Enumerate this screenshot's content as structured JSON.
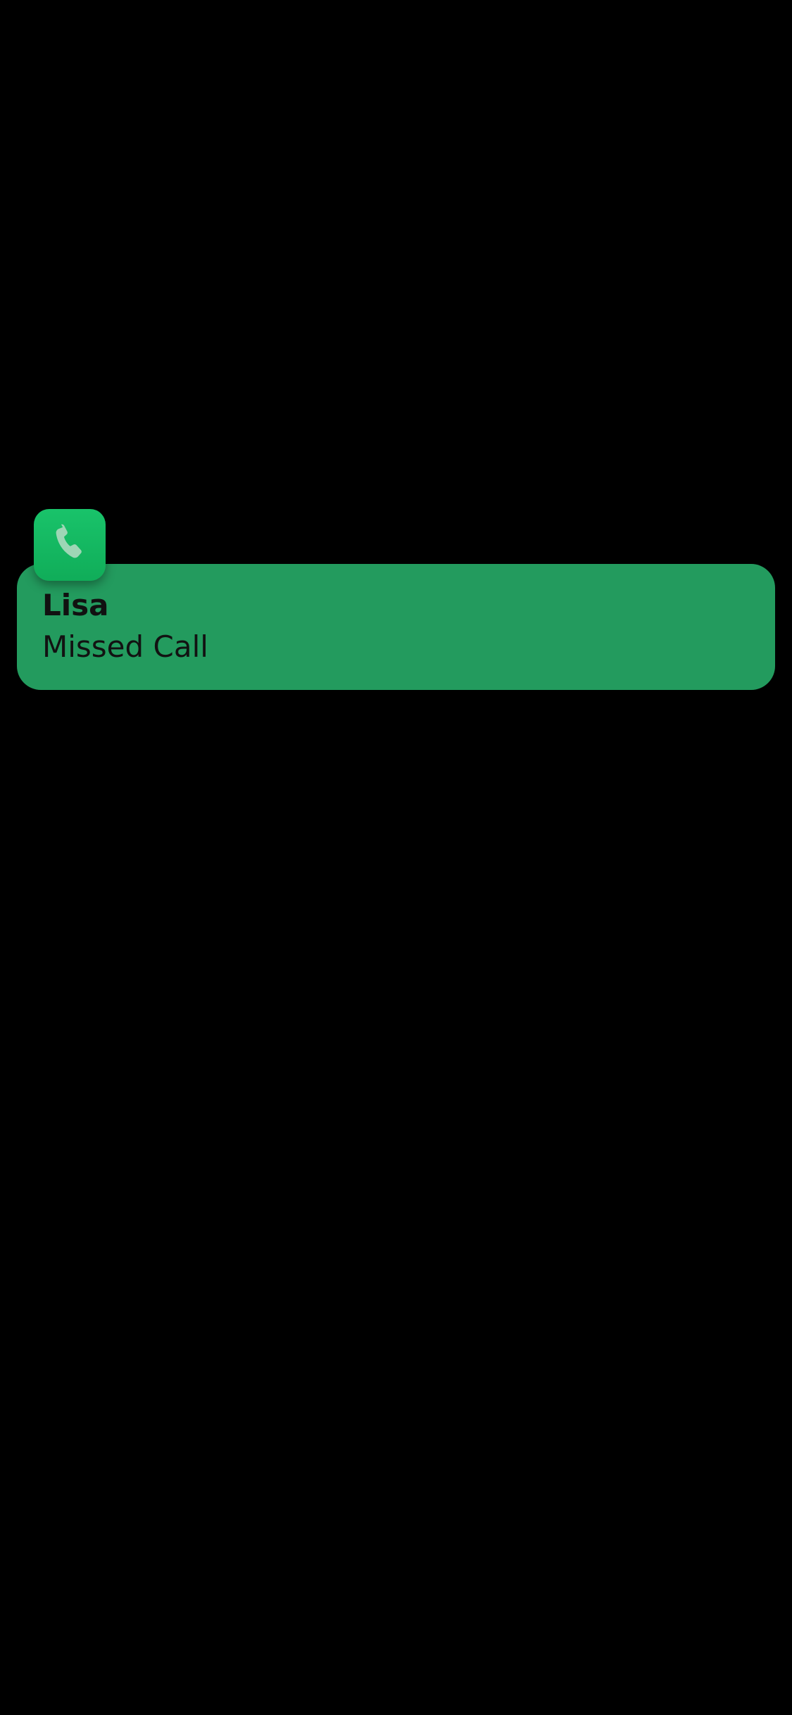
{
  "notification": {
    "app_icon": "phone-icon",
    "title": "Lisa",
    "message": "Missed Call"
  },
  "colors": {
    "background": "#000000",
    "notification_bg": "#239b5e",
    "icon_bg": "#16b864",
    "text": "#111111"
  }
}
